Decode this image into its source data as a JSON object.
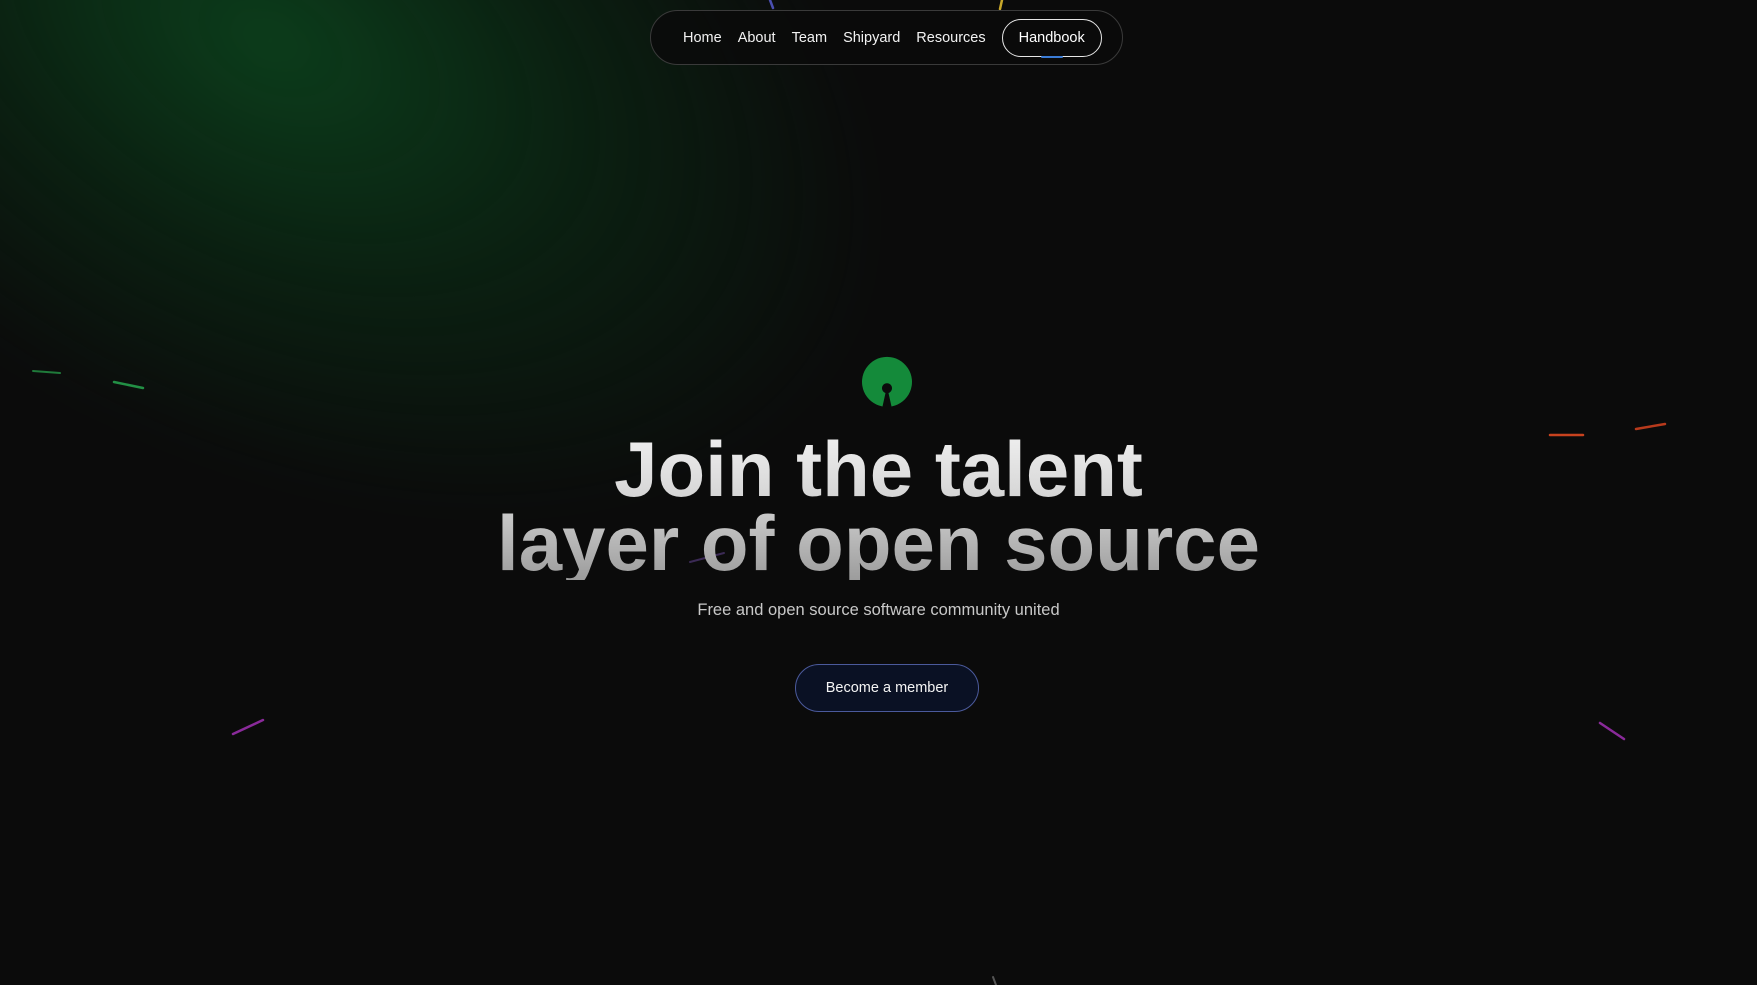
{
  "nav": {
    "items": [
      {
        "label": "Home"
      },
      {
        "label": "About"
      },
      {
        "label": "Team"
      },
      {
        "label": "Shipyard"
      },
      {
        "label": "Resources"
      }
    ],
    "handbook_label": "Handbook"
  },
  "hero": {
    "logo_icon": "open-source-keyhole-icon",
    "title_line1": "Join the talent",
    "title_line2": "layer of open source",
    "subtitle": "Free and open source software community united",
    "cta_label": "Become a member"
  },
  "colors": {
    "background": "#0b0b0b",
    "logo_green": "#148a3a",
    "glow_green": "#0c461e",
    "cta_border": "#4b5a9c",
    "cta_background": "#0a1124"
  }
}
